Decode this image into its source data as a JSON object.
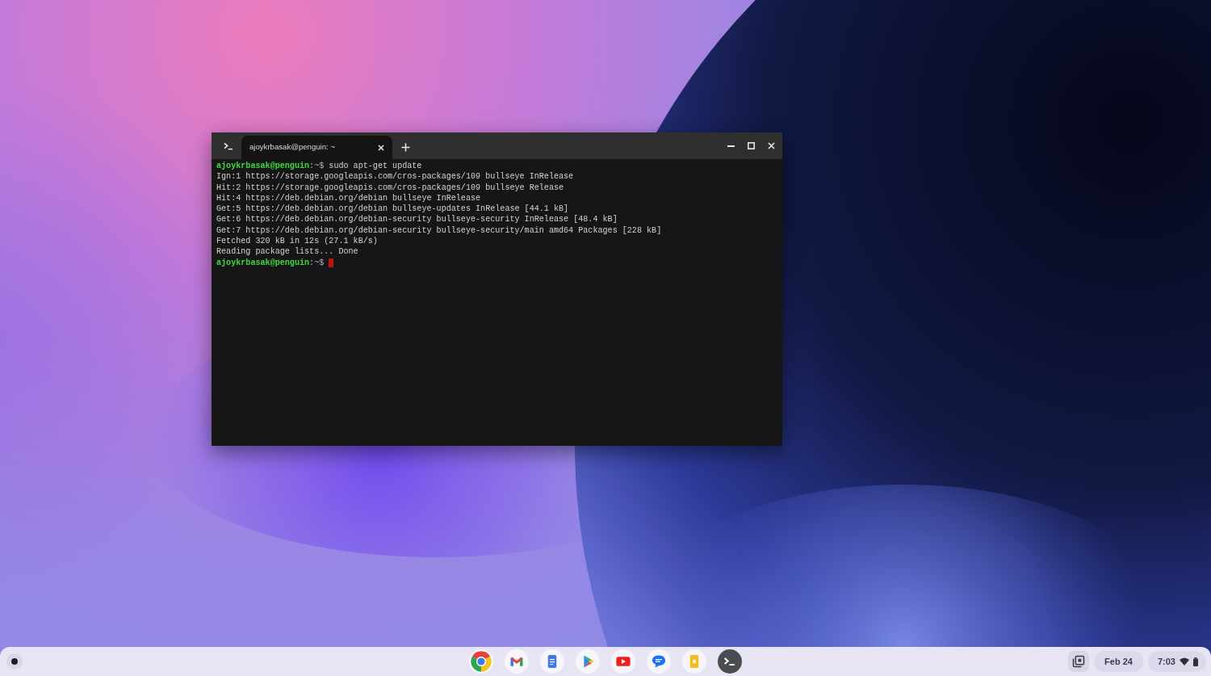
{
  "terminal": {
    "tabs": [
      {
        "label": "ajoykrbasak@penguin: ~",
        "selected": true
      }
    ],
    "lines": [
      {
        "kind": "prompt",
        "user": "ajoykrbasak@penguin",
        "path": ":~$",
        "command": "sudo apt-get update",
        "cursor": false
      },
      {
        "kind": "output",
        "text": "Ign:1 https://storage.googleapis.com/cros-packages/109 bullseye InRelease"
      },
      {
        "kind": "output",
        "text": "Hit:2 https://storage.googleapis.com/cros-packages/109 bullseye Release"
      },
      {
        "kind": "output",
        "text": "Hit:4 https://deb.debian.org/debian bullseye InRelease"
      },
      {
        "kind": "output",
        "text": "Get:5 https://deb.debian.org/debian bullseye-updates InRelease [44.1 kB]"
      },
      {
        "kind": "output",
        "text": "Get:6 https://deb.debian.org/debian-security bullseye-security InRelease [48.4 kB]"
      },
      {
        "kind": "output",
        "text": "Get:7 https://deb.debian.org/debian-security bullseye-security/main amd64 Packages [228 kB]"
      },
      {
        "kind": "output",
        "text": "Fetched 320 kB in 12s (27.1 kB/s)"
      },
      {
        "kind": "output",
        "text": "Reading package lists... Done"
      },
      {
        "kind": "prompt",
        "user": "ajoykrbasak@penguin",
        "path": ":~$",
        "cursor": true
      }
    ]
  },
  "shelf": {
    "date": "Feb 24",
    "time": "7:03"
  }
}
